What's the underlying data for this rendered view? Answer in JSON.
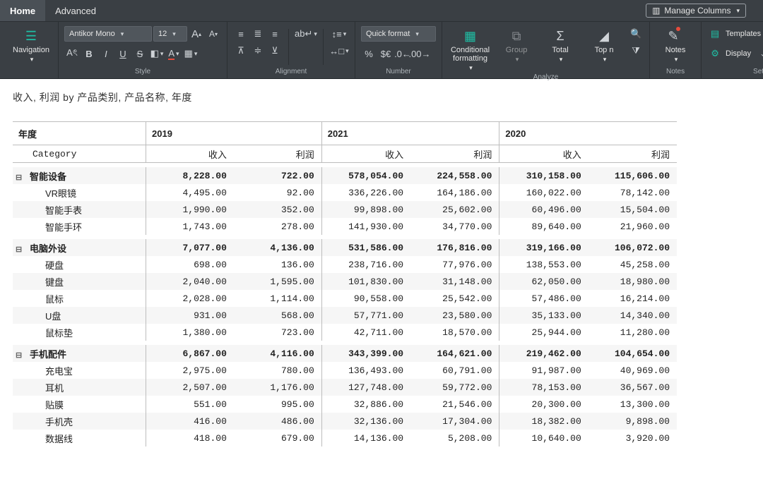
{
  "tabs": {
    "home": "Home",
    "advanced": "Advanced"
  },
  "manage_columns": "Manage Columns",
  "ribbon": {
    "navigation": "Navigation",
    "font_family": "Antikor Mono",
    "font_size": "12",
    "quick_format": "Quick format",
    "conditional_formatting": "Conditional\nformatting",
    "group": "Group",
    "total": "Total",
    "top_n": "Top n",
    "notes": "Notes",
    "templates": "Templates",
    "display": "Display",
    "labels": {
      "style": "Style",
      "alignment": "Alignment",
      "number": "Number",
      "analyze": "Analyze",
      "notes": "Notes",
      "setup": "Setup"
    }
  },
  "page_title": "收入, 利润 by 产品类别, 产品名称, 年度",
  "chart_data": {
    "type": "table",
    "row_dimension": "产品类别 / 产品名称",
    "column_dimension": "年度",
    "measures": [
      "收入",
      "利润"
    ],
    "corner_year": "年度",
    "corner_category": "Category",
    "years": [
      "2019",
      "2021",
      "2020"
    ],
    "groups": [
      {
        "name": "智能设备",
        "totals": {
          "2019": {
            "收入": "8,228.00",
            "利润": "722.00"
          },
          "2021": {
            "收入": "578,054.00",
            "利润": "224,558.00"
          },
          "2020": {
            "收入": "310,158.00",
            "利润": "115,606.00"
          }
        },
        "rows": [
          {
            "name": "VR眼镜",
            "2019": {
              "收入": "4,495.00",
              "利润": "92.00"
            },
            "2021": {
              "收入": "336,226.00",
              "利润": "164,186.00"
            },
            "2020": {
              "收入": "160,022.00",
              "利润": "78,142.00"
            }
          },
          {
            "name": "智能手表",
            "2019": {
              "收入": "1,990.00",
              "利润": "352.00"
            },
            "2021": {
              "收入": "99,898.00",
              "利润": "25,602.00"
            },
            "2020": {
              "收入": "60,496.00",
              "利润": "15,504.00"
            }
          },
          {
            "name": "智能手环",
            "2019": {
              "收入": "1,743.00",
              "利润": "278.00"
            },
            "2021": {
              "收入": "141,930.00",
              "利润": "34,770.00"
            },
            "2020": {
              "收入": "89,640.00",
              "利润": "21,960.00"
            }
          }
        ]
      },
      {
        "name": "电脑外设",
        "totals": {
          "2019": {
            "收入": "7,077.00",
            "利润": "4,136.00"
          },
          "2021": {
            "收入": "531,586.00",
            "利润": "176,816.00"
          },
          "2020": {
            "收入": "319,166.00",
            "利润": "106,072.00"
          }
        },
        "rows": [
          {
            "name": "硬盘",
            "2019": {
              "收入": "698.00",
              "利润": "136.00"
            },
            "2021": {
              "收入": "238,716.00",
              "利润": "77,976.00"
            },
            "2020": {
              "收入": "138,553.00",
              "利润": "45,258.00"
            }
          },
          {
            "name": "键盘",
            "2019": {
              "收入": "2,040.00",
              "利润": "1,595.00"
            },
            "2021": {
              "收入": "101,830.00",
              "利润": "31,148.00"
            },
            "2020": {
              "收入": "62,050.00",
              "利润": "18,980.00"
            }
          },
          {
            "name": "鼠标",
            "2019": {
              "收入": "2,028.00",
              "利润": "1,114.00"
            },
            "2021": {
              "收入": "90,558.00",
              "利润": "25,542.00"
            },
            "2020": {
              "收入": "57,486.00",
              "利润": "16,214.00"
            }
          },
          {
            "name": "U盘",
            "2019": {
              "收入": "931.00",
              "利润": "568.00"
            },
            "2021": {
              "收入": "57,771.00",
              "利润": "23,580.00"
            },
            "2020": {
              "收入": "35,133.00",
              "利润": "14,340.00"
            }
          },
          {
            "name": "鼠标垫",
            "2019": {
              "收入": "1,380.00",
              "利润": "723.00"
            },
            "2021": {
              "收入": "42,711.00",
              "利润": "18,570.00"
            },
            "2020": {
              "收入": "25,944.00",
              "利润": "11,280.00"
            }
          }
        ]
      },
      {
        "name": "手机配件",
        "totals": {
          "2019": {
            "收入": "6,867.00",
            "利润": "4,116.00"
          },
          "2021": {
            "收入": "343,399.00",
            "利润": "164,621.00"
          },
          "2020": {
            "收入": "219,462.00",
            "利润": "104,654.00"
          }
        },
        "rows": [
          {
            "name": "充电宝",
            "2019": {
              "收入": "2,975.00",
              "利润": "780.00"
            },
            "2021": {
              "收入": "136,493.00",
              "利润": "60,791.00"
            },
            "2020": {
              "收入": "91,987.00",
              "利润": "40,969.00"
            }
          },
          {
            "name": "耳机",
            "2019": {
              "收入": "2,507.00",
              "利润": "1,176.00"
            },
            "2021": {
              "收入": "127,748.00",
              "利润": "59,772.00"
            },
            "2020": {
              "收入": "78,153.00",
              "利润": "36,567.00"
            }
          },
          {
            "name": "贴膜",
            "2019": {
              "收入": "551.00",
              "利润": "995.00"
            },
            "2021": {
              "收入": "32,886.00",
              "利润": "21,546.00"
            },
            "2020": {
              "收入": "20,300.00",
              "利润": "13,300.00"
            }
          },
          {
            "name": "手机壳",
            "2019": {
              "收入": "416.00",
              "利润": "486.00"
            },
            "2021": {
              "收入": "32,136.00",
              "利润": "17,304.00"
            },
            "2020": {
              "收入": "18,382.00",
              "利润": "9,898.00"
            }
          },
          {
            "name": "数据线",
            "2019": {
              "收入": "418.00",
              "利润": "679.00"
            },
            "2021": {
              "收入": "14,136.00",
              "利润": "5,208.00"
            },
            "2020": {
              "收入": "10,640.00",
              "利润": "3,920.00"
            }
          }
        ]
      }
    ]
  }
}
